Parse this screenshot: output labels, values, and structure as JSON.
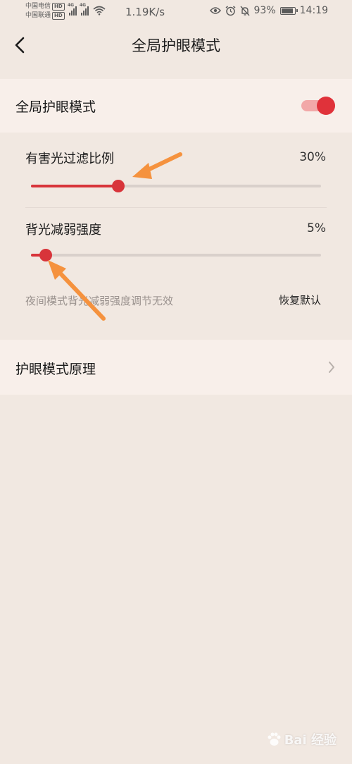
{
  "status_bar": {
    "carrier1": "中国电信",
    "carrier2": "中国联通",
    "hd_badge": "HD",
    "network_type": "4G",
    "net_speed": "1.19K/s",
    "battery_percent": "93%",
    "battery_level": 0.93,
    "time": "14:19",
    "icons": [
      "eye-icon",
      "alarm-icon",
      "mute-icon",
      "battery-icon"
    ]
  },
  "header": {
    "title": "全局护眼模式"
  },
  "global_toggle": {
    "label": "全局护眼模式",
    "enabled": true,
    "on_color": "#e0323a"
  },
  "sliders": [
    {
      "label": "有害光过滤比例",
      "value_text": "30%",
      "value": 30
    },
    {
      "label": "背光减弱强度",
      "value_text": "5%",
      "value": 5
    }
  ],
  "hint": "夜间模式背光减弱强度调节无效",
  "reset_label": "恢复默认",
  "principle": {
    "label": "护眼模式原理"
  },
  "watermark": "Bai 经验",
  "colors": {
    "accent": "#d8343a",
    "annotation_arrow": "#f5923e"
  }
}
